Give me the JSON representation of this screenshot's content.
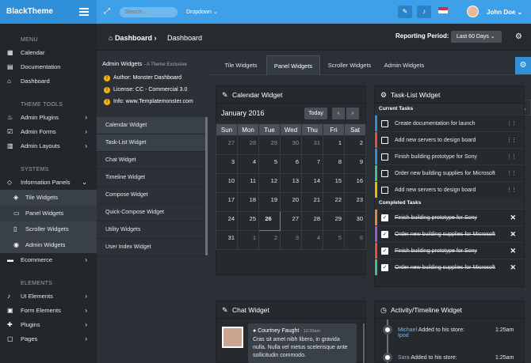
{
  "topbar": {
    "brand": "BlackTheme",
    "search_placeholder": "Search...",
    "dropdown": "Dropdown ⌄",
    "user": "John Doe ⌄"
  },
  "sidebar": {
    "menu_heading": "MENU",
    "menu": [
      "Calendar",
      "Documentation",
      "Dashboard"
    ],
    "tools_heading": "THEME TOOLS",
    "tools": [
      "Admin Plugins",
      "Admin Forms",
      "Admin Layouts"
    ],
    "systems_heading": "SYSTEMS",
    "panels": "Information Panels",
    "sub": [
      "Tile Widgets",
      "Panel Widgets",
      "Scroller Widgets",
      "Admin Widgets"
    ],
    "ecommerce": "Ecommerce",
    "elements_heading": "ELEMENTS",
    "elements": [
      "UI Elements",
      "Form Elements",
      "Plugins",
      "Pages"
    ]
  },
  "crumb": {
    "title": "Dashboard",
    "current": "Dashboard"
  },
  "reporting": {
    "label": "Reporting Period:",
    "value": "Last 60 Days ⌄"
  },
  "admin_widgets": {
    "title": "Admin Widgets",
    "subtitle": "- A Theme Exclusive",
    "author": "Author: Monster Dashboard",
    "license": "License: CC - Commercial 3.0",
    "info": "Info: www.Templatemonster.com"
  },
  "widget_list": [
    "Calendar Widget",
    "Task-List Widget",
    "Chat Widget",
    "Timeline Widget",
    "Compose Widget",
    "Quick-Compose Widget",
    "Utility Widgets",
    "User Index Widget"
  ],
  "tabs": [
    "Tile Widgets",
    "Panel Widgets",
    "Scroller Widgets",
    "Admin Widgets"
  ],
  "calendar": {
    "title": "Calendar Widget",
    "month": "January 2016",
    "today": "Today",
    "days": [
      "Sun",
      "Mon",
      "Tue",
      "Wed",
      "Thu",
      "Fri",
      "Sat"
    ],
    "weeks": [
      [
        "27",
        "28",
        "29",
        "30",
        "31",
        "1",
        "2"
      ],
      [
        "3",
        "4",
        "5",
        "6",
        "7",
        "8",
        "9"
      ],
      [
        "10",
        "11",
        "12",
        "13",
        "14",
        "15",
        "16"
      ],
      [
        "17",
        "18",
        "19",
        "20",
        "21",
        "22",
        "23"
      ],
      [
        "24",
        "25",
        "26",
        "27",
        "28",
        "29",
        "30"
      ],
      [
        "31",
        "1",
        "2",
        "3",
        "4",
        "5",
        "6"
      ]
    ]
  },
  "tasks": {
    "title": "Task-List Widget",
    "current_heading": "Current Tasks",
    "current": [
      "Create documentation for launch",
      "Add new servers to design board",
      "Finish building prototype for Sony",
      "Order new building supplies for Microsoft",
      "Add new servers to design board"
    ],
    "completed_heading": "Completed Tasks",
    "completed": [
      "Finish building prototype for Sony",
      "Order new building supplies for Microsoft",
      "Finish building prototype for Sony",
      "Order new building supplies for Microsoft"
    ]
  },
  "chat": {
    "title": "Chat Widget",
    "name": "Courtney Faught",
    "time": "- 12:30am",
    "text": "Cras sit amet nibh libero, in gravida nulla. Nulla vel metus scelerisque ante sollicitudin commodo."
  },
  "activity": {
    "title": "Activity/Timeline Widget",
    "items": [
      {
        "name": "Michael",
        "text": "Added to his store:",
        "link": "Ipod",
        "time": "1:25am"
      },
      {
        "name": "Sara",
        "text": "Added to his store:",
        "time": "1:25am"
      }
    ]
  }
}
